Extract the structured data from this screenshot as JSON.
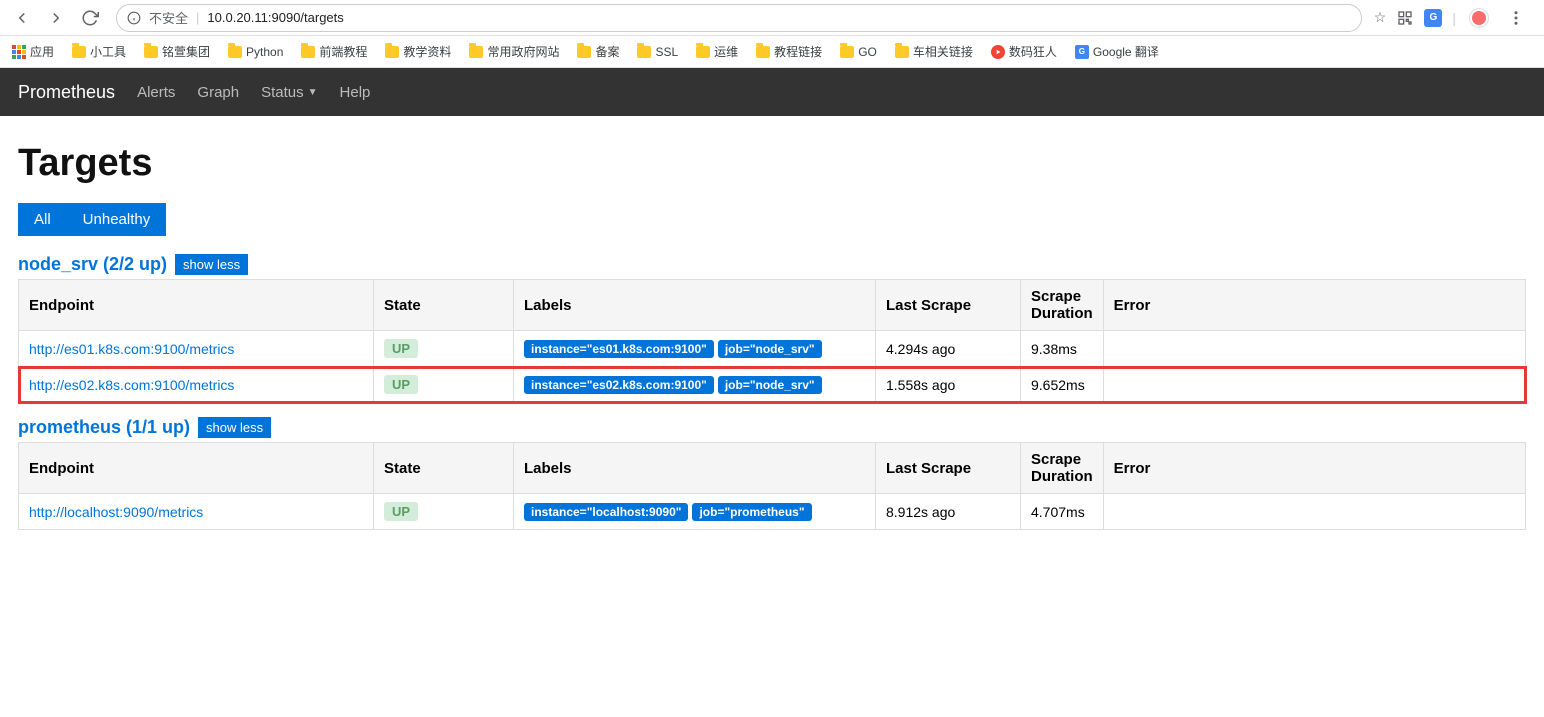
{
  "browser": {
    "insecure_label": "不安全",
    "url": "10.0.20.11:9090/targets"
  },
  "bookmarks": {
    "apps": "应用",
    "items": [
      "小工具",
      "铭萱集团",
      "Python",
      "前端教程",
      "教学资料",
      "常用政府网站",
      "备案",
      "SSL",
      "运维",
      "教程链接",
      "GO",
      "车相关链接"
    ],
    "digit_mad": "数码狂人",
    "gtranslate": "Google 翻译"
  },
  "nav": {
    "brand": "Prometheus",
    "alerts": "Alerts",
    "graph": "Graph",
    "status": "Status",
    "help": "Help"
  },
  "page": {
    "title": "Targets",
    "filter_all": "All",
    "filter_unhealthy": "Unhealthy",
    "showless": "show less",
    "headers": {
      "endpoint": "Endpoint",
      "state": "State",
      "labels": "Labels",
      "last_scrape": "Last Scrape",
      "scrape_duration": "Scrape Duration",
      "error": "Error"
    }
  },
  "jobs": [
    {
      "title": "node_srv (2/2 up)",
      "rows": [
        {
          "endpoint": "http://es01.k8s.com:9100/metrics",
          "state": "UP",
          "label_instance": "instance=\"es01.k8s.com:9100\"",
          "label_job": "job=\"node_srv\"",
          "last_scrape": "4.294s ago",
          "duration": "9.38ms",
          "error": "",
          "highlight": false
        },
        {
          "endpoint": "http://es02.k8s.com:9100/metrics",
          "state": "UP",
          "label_instance": "instance=\"es02.k8s.com:9100\"",
          "label_job": "job=\"node_srv\"",
          "last_scrape": "1.558s ago",
          "duration": "9.652ms",
          "error": "",
          "highlight": true
        }
      ]
    },
    {
      "title": "prometheus (1/1 up)",
      "rows": [
        {
          "endpoint": "http://localhost:9090/metrics",
          "state": "UP",
          "label_instance": "instance=\"localhost:9090\"",
          "label_job": "job=\"prometheus\"",
          "last_scrape": "8.912s ago",
          "duration": "4.707ms",
          "error": "",
          "highlight": false
        }
      ]
    }
  ]
}
